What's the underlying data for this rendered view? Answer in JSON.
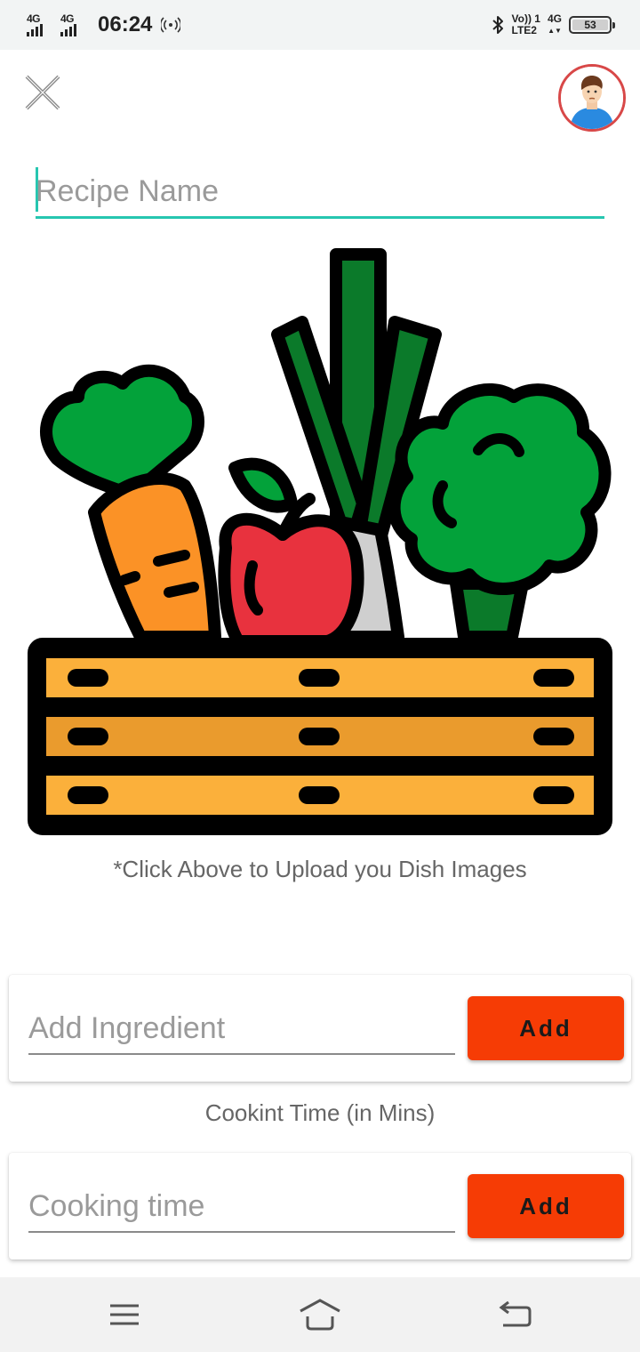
{
  "status_bar": {
    "sim1_network": "4G",
    "sim2_network": "4G",
    "time": "06:24",
    "volte_label": "Vo))",
    "lte_label": "LTE2",
    "sim_slot": "1",
    "data_network": "4G",
    "battery_level": "53",
    "icons": [
      "signal-icon",
      "hotspot-icon",
      "bluetooth-icon",
      "battery-icon"
    ]
  },
  "header": {
    "close_icon": "close-icon",
    "avatar_icon": "user-avatar"
  },
  "recipe": {
    "name_placeholder": "Recipe Name",
    "name_value": ""
  },
  "upload": {
    "image_icon": "vegetable-crate-illustration",
    "hint": "*Click Above to Upload you Dish Images"
  },
  "ingredient": {
    "placeholder": "Add Ingredient",
    "value": "",
    "button_label": "Add"
  },
  "cooking_time": {
    "label": "Cookint Time (in Mins)",
    "placeholder": "Cooking time",
    "value": "",
    "button_label": "Add"
  },
  "colors": {
    "accent": "#26c6b0",
    "button": "#f63c05",
    "avatar_ring": "#d84848"
  },
  "nav_bar": {
    "icons": [
      "menu-icon",
      "home-icon",
      "back-icon"
    ]
  }
}
